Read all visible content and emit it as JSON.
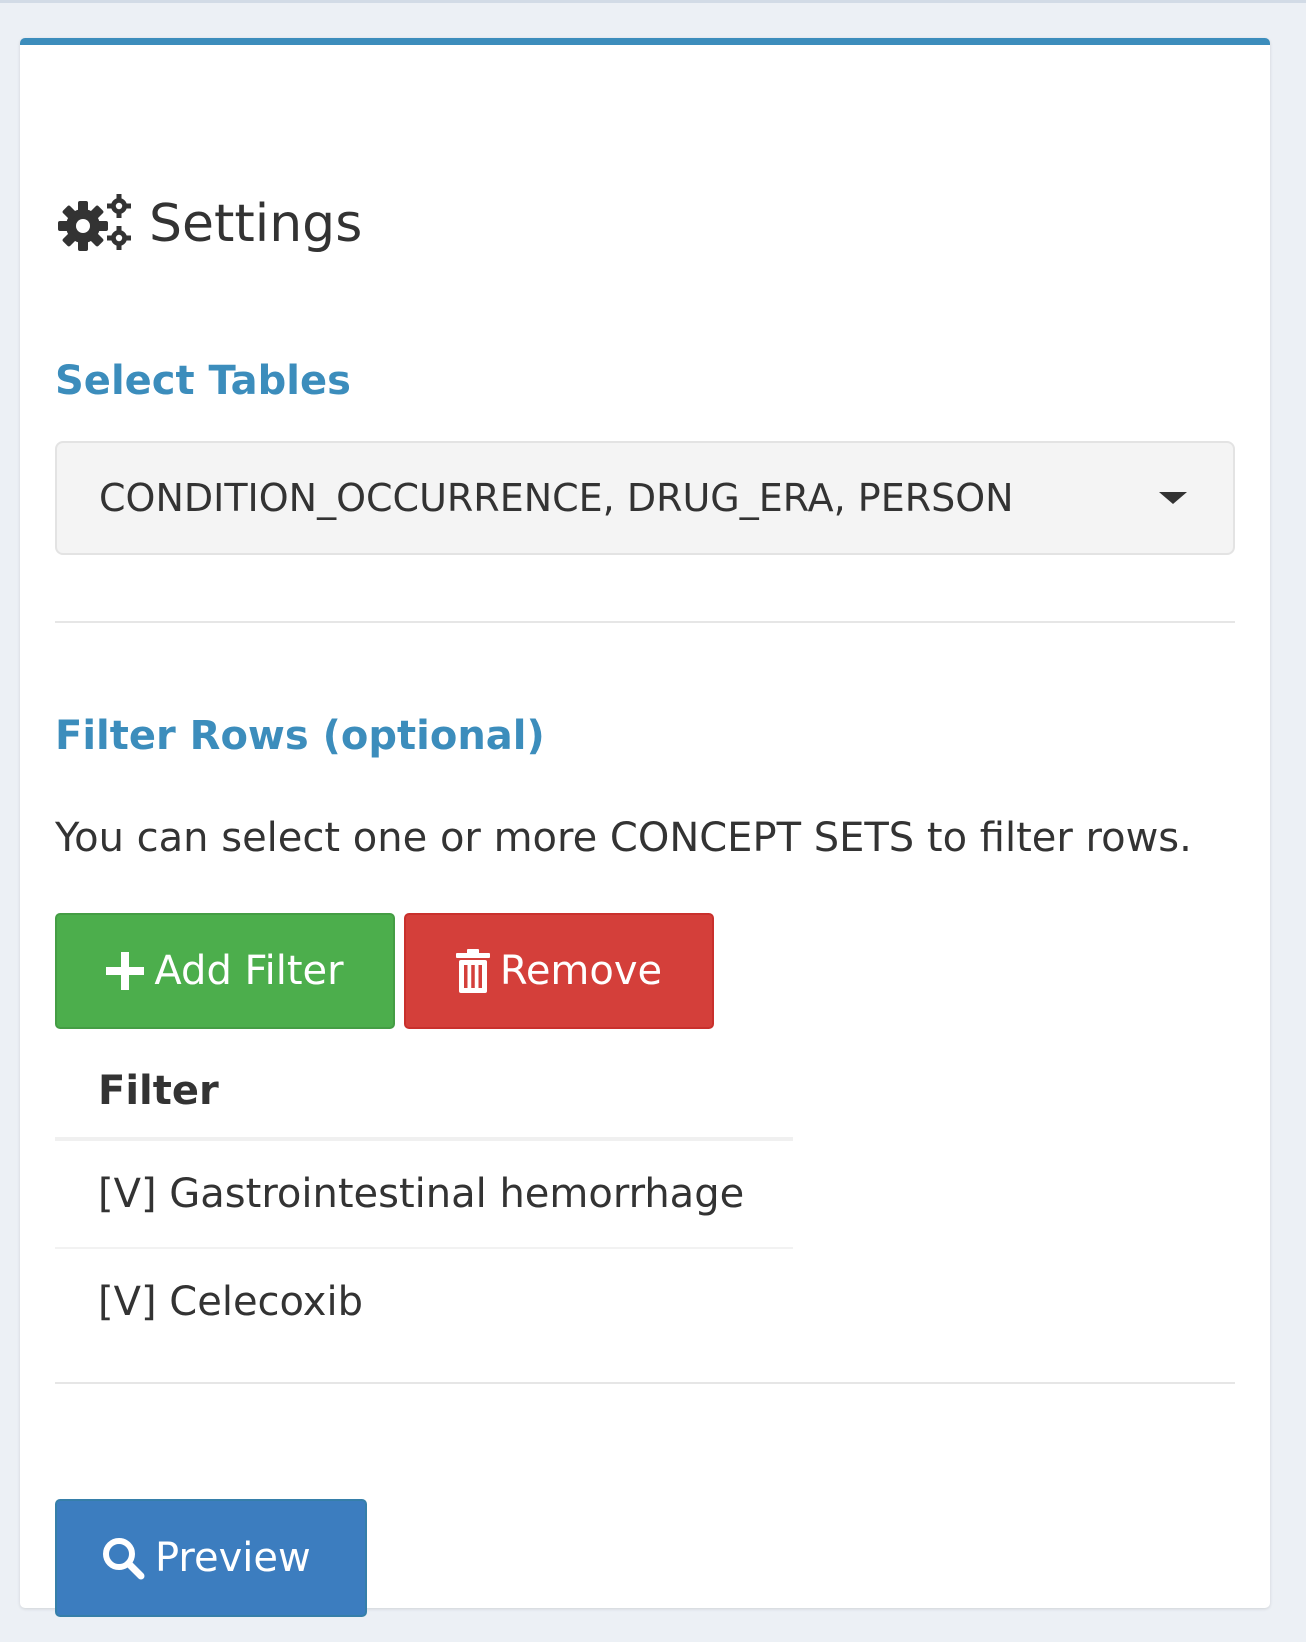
{
  "panel": {
    "title": "Settings",
    "title_icon": "gears-icon",
    "accent_color": "#3c8dbc"
  },
  "tables": {
    "label": "Select Tables",
    "selected_value": "CONDITION_OCCURRENCE, DRUG_ERA, PERSON",
    "dropdown_icon": "caret-down-icon"
  },
  "filters": {
    "label": "Filter Rows (optional)",
    "help_text": "You can select one or more CONCEPT SETS to filter rows.",
    "add_button": {
      "label": "Add Filter",
      "icon": "plus-icon",
      "color": "#5cb85c"
    },
    "remove_button": {
      "label": "Remove",
      "icon": "trash-icon",
      "color": "#d9534f"
    },
    "table": {
      "header": "Filter",
      "rows": [
        {
          "label": "[V] Gastrointestinal hemorrhage"
        },
        {
          "label": "[V] Celecoxib"
        }
      ]
    }
  },
  "preview_button": {
    "label": "Preview",
    "icon": "search-icon",
    "color": "#3c8dbc"
  }
}
